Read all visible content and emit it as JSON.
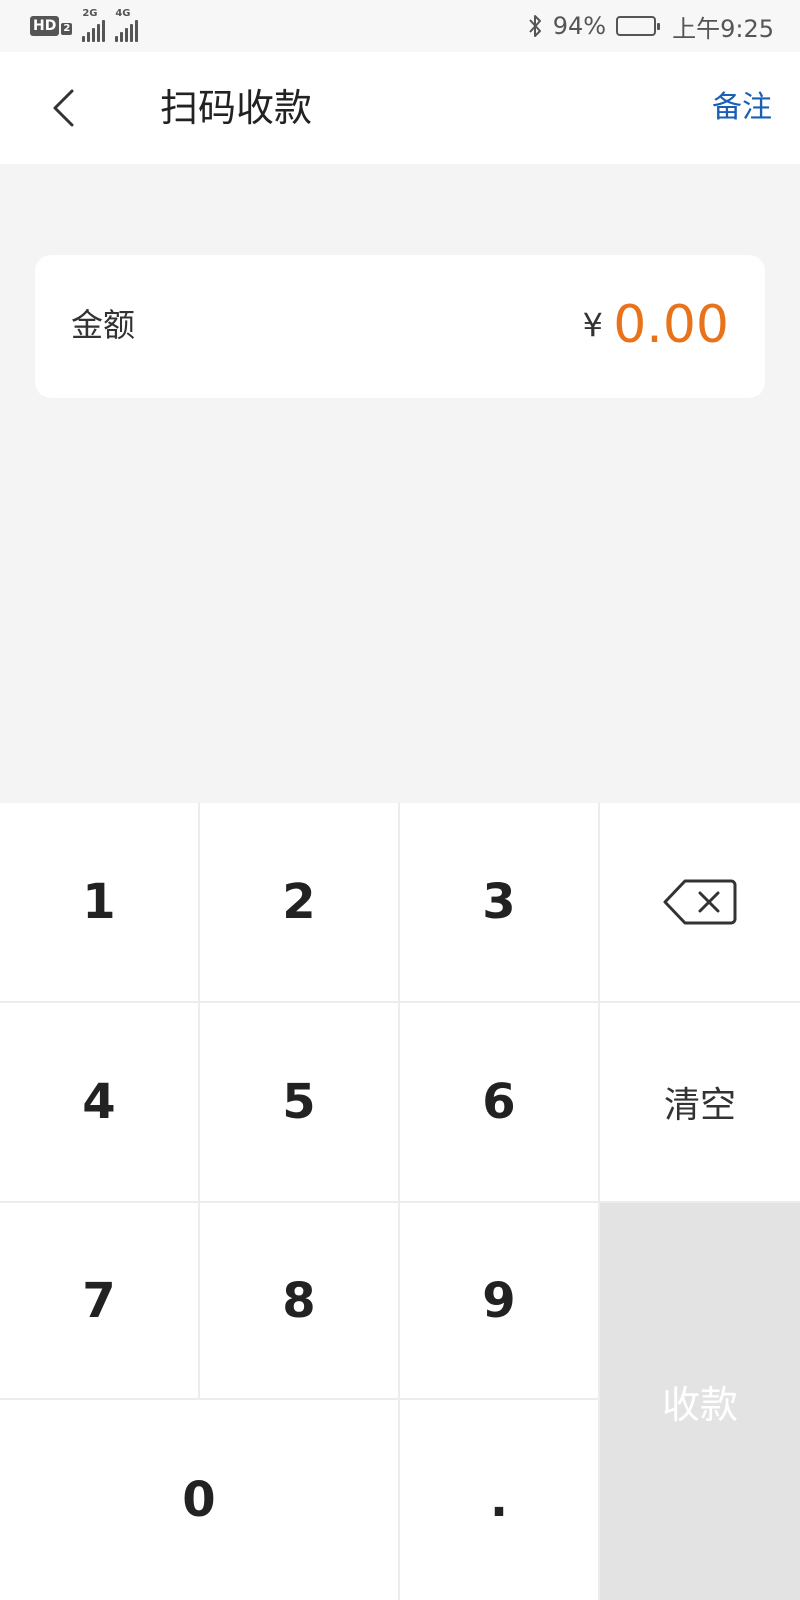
{
  "status_bar": {
    "hd_label": "HD",
    "hd_sub": "2",
    "net1": "2G",
    "net2": "4G",
    "battery": "94%",
    "time": "上午9:25"
  },
  "header": {
    "title": "扫码收款",
    "remark_label": "备注",
    "accent_color": "#1a5fb4"
  },
  "amount": {
    "label": "金额",
    "currency": "¥",
    "value": "0.00",
    "value_color": "#e8731a"
  },
  "keypad": {
    "k1": "1",
    "k2": "2",
    "k3": "3",
    "k4": "4",
    "k5": "5",
    "k6": "6",
    "k7": "7",
    "k8": "8",
    "k9": "9",
    "k0": "0",
    "dot": ".",
    "clear_label": "清空",
    "submit_label": "收款",
    "backspace_icon": "backspace-icon"
  }
}
